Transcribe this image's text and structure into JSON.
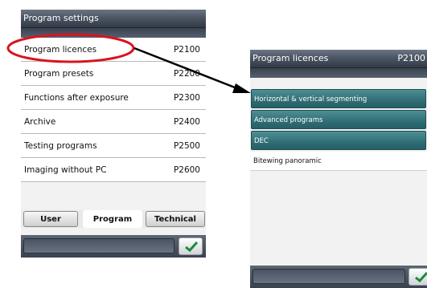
{
  "left_panel": {
    "title": "Program settings",
    "items": [
      {
        "label": "Program licences",
        "code": "P2100"
      },
      {
        "label": "Program presets",
        "code": "P2200"
      },
      {
        "label": "Functions after exposure",
        "code": "P2300"
      },
      {
        "label": "Archive",
        "code": "P2400"
      },
      {
        "label": "Testing programs",
        "code": "P2500"
      },
      {
        "label": "Imaging without PC",
        "code": "P2600"
      }
    ],
    "tabs": [
      {
        "label": "User"
      },
      {
        "label": "Program"
      },
      {
        "label": "Technical"
      }
    ]
  },
  "right_panel": {
    "title": "Program licences",
    "code": "P2100",
    "licences": [
      {
        "label": "Horizontal & vertical segmenting",
        "enabled": true
      },
      {
        "label": "Advanced programs",
        "enabled": true
      },
      {
        "label": "DEC",
        "enabled": true
      },
      {
        "label": "Bitewing panoramic",
        "enabled": false
      }
    ]
  },
  "annotation": {
    "highlight_color": "#d9141e",
    "arrow_color": "#000000",
    "teal_color": "#2f6e74"
  },
  "icons": {
    "confirm": "check-icon",
    "pointer": "arrow-icon"
  }
}
